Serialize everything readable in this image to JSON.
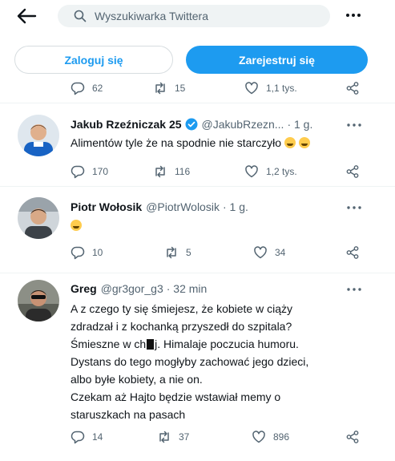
{
  "search": {
    "placeholder": "Wyszukiwarka Twittera"
  },
  "auth": {
    "login_label": "Zaloguj się",
    "register_label": "Zarejestruj się"
  },
  "prev_tweet_actions": {
    "replies": "62",
    "retweets": "15",
    "likes": "1,1 tys."
  },
  "tweets": [
    {
      "name": "Jakub Rzeźniczak 25",
      "verified": true,
      "handle": "@JakubRzezn...",
      "time": "· 1 g.",
      "lines": [
        "Alimentów tyle że na spodnie nie starczyło"
      ],
      "emoji_after_text": [
        "grinning-sweat-emoji",
        "rofl-emoji"
      ],
      "replies": "170",
      "retweets": "116",
      "likes": "1,2 tys."
    },
    {
      "name": "Piotr Wołosik",
      "verified": false,
      "handle": "@PiotrWolosik",
      "time": "· 1 g.",
      "lines": [],
      "emoji_after_text": [
        "rofl-emoji"
      ],
      "replies": "10",
      "retweets": "5",
      "likes": "34"
    },
    {
      "name": "Greg",
      "verified": false,
      "handle": "@gr3gor_g3",
      "time": "· 32 min",
      "lines": [
        "A z czego ty się śmiejesz, że kobiete w ciąży",
        "zdradzał i z kochanką przyszedł do szpitala?",
        "Śmieszne w ch",
        "j. Himalaje poczucia humoru.",
        "Dystans do tego mogłyby zachować jego dzieci,",
        "albo byłe kobiety, a nie on.",
        "Czekam aż Hajto będzie wstawiał memy o",
        "staruszkach na pasach"
      ],
      "replies": "14",
      "retweets": "37",
      "likes": "896"
    }
  ],
  "colors": {
    "accent": "#1d9bf0",
    "muted": "#536471",
    "text": "#0f1419",
    "divider": "#eff3f4"
  }
}
